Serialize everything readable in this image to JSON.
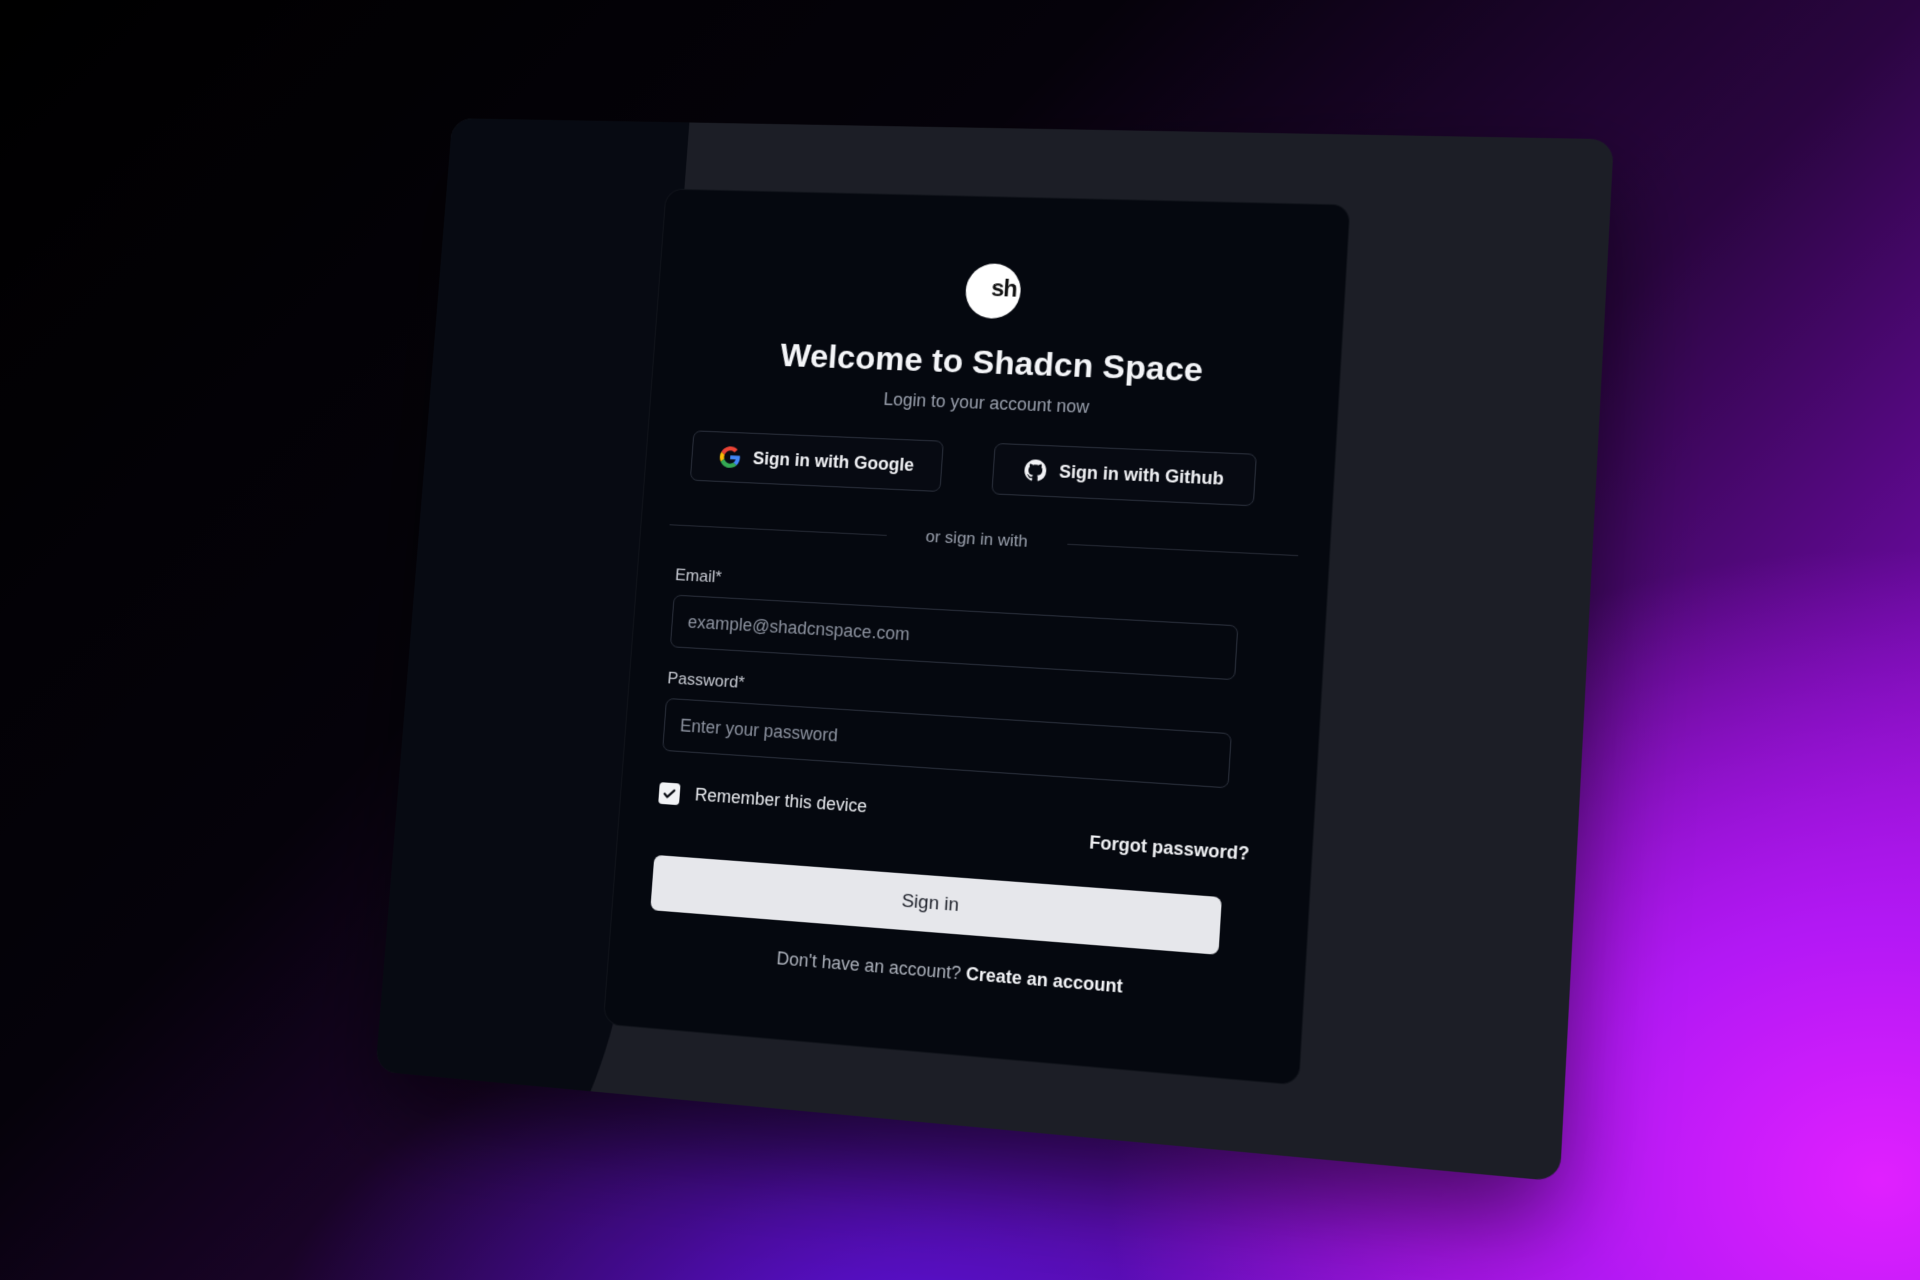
{
  "brand": {
    "logo_text": "sh"
  },
  "header": {
    "title": "Welcome to Shadcn Space",
    "subtitle": "Login to your account now"
  },
  "oauth": {
    "google_label": "Sign in with Google",
    "github_label": "Sign in with Github"
  },
  "divider": {
    "text": "or sign in with"
  },
  "form": {
    "email_label": "Email*",
    "email_placeholder": "example@shadcnspace.com",
    "password_label": "Password*",
    "password_placeholder": "Enter your password",
    "remember_label": "Remember this device",
    "remember_checked": true,
    "forgot_label": "Forgot password?",
    "submit_label": "Sign in"
  },
  "footer": {
    "prompt": "Don't have an account?",
    "link_label": "Create an account"
  },
  "colors": {
    "accent_magenta": "#e020ff",
    "accent_violet": "#5a10d8",
    "panel": "#1c1e26",
    "card": "#05080f"
  },
  "icons": [
    "google-icon",
    "github-icon",
    "check-icon"
  ]
}
